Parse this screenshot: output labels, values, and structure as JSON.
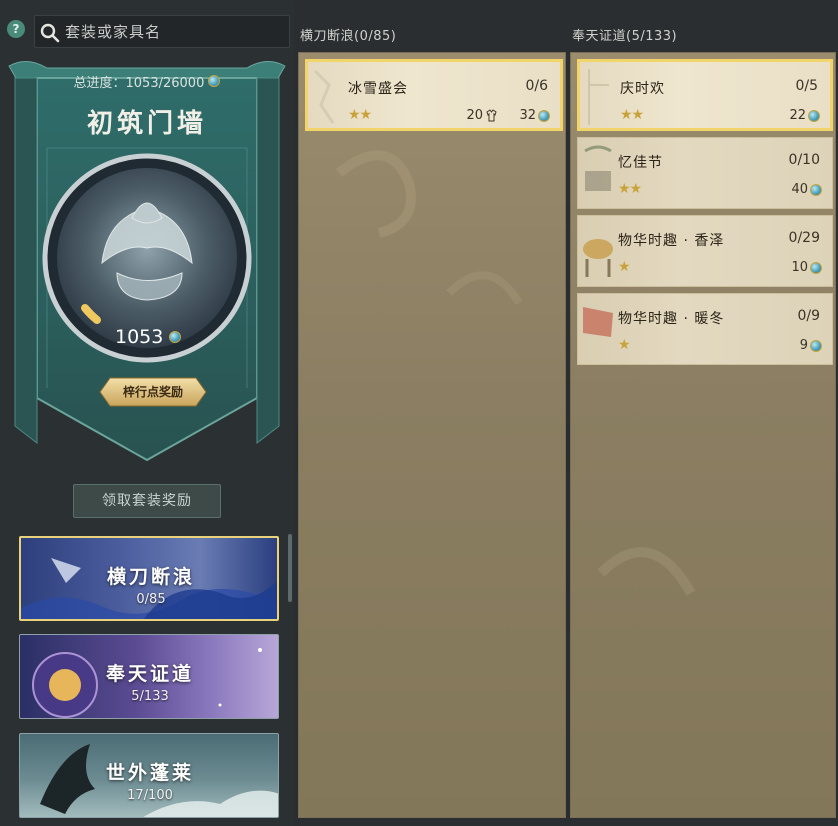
{
  "search": {
    "placeholder": "套装或家具名"
  },
  "banner": {
    "total_progress": "总进度：1053/26000",
    "title": "初筑门墙",
    "ring_value": "1053",
    "reward_button": "梓行点奖励"
  },
  "claim_button": "领取套装奖励",
  "categories": [
    {
      "name": "横刀断浪",
      "progress": "0/85"
    },
    {
      "name": "奉天证道",
      "progress": "5/133"
    },
    {
      "name": "世外蓬莱",
      "progress": "17/100"
    }
  ],
  "columns": [
    {
      "header": "横刀断浪(0/85)",
      "items": [
        {
          "name": "冰雪盛会",
          "progress": "0/6",
          "stars": "★★",
          "reward_a": "20",
          "reward_b": "32"
        }
      ]
    },
    {
      "header": "奉天证道(5/133)",
      "items": [
        {
          "name": "庆时欢",
          "progress": "0/5",
          "stars": "★★",
          "reward_b": "22"
        },
        {
          "name": "忆佳节",
          "progress": "0/10",
          "stars": "★★",
          "reward_b": "40"
        },
        {
          "name": "物华时趣 · 香泽",
          "progress": "0/29",
          "stars": "★",
          "reward_b": "10"
        },
        {
          "name": "物华时趣 · 暖冬",
          "progress": "0/9",
          "stars": "★",
          "reward_b": "9"
        }
      ]
    }
  ],
  "icons": {
    "help": "question-icon",
    "search": "search-icon",
    "currency": "jade-coin-icon",
    "outfit": "outfit-icon",
    "star": "star-icon"
  },
  "colors": {
    "selected_border": "#f2d56a",
    "banner_teal": "#2e6a68",
    "panel_tan": "#8b7e62",
    "card_cream": "#ece3cc"
  }
}
